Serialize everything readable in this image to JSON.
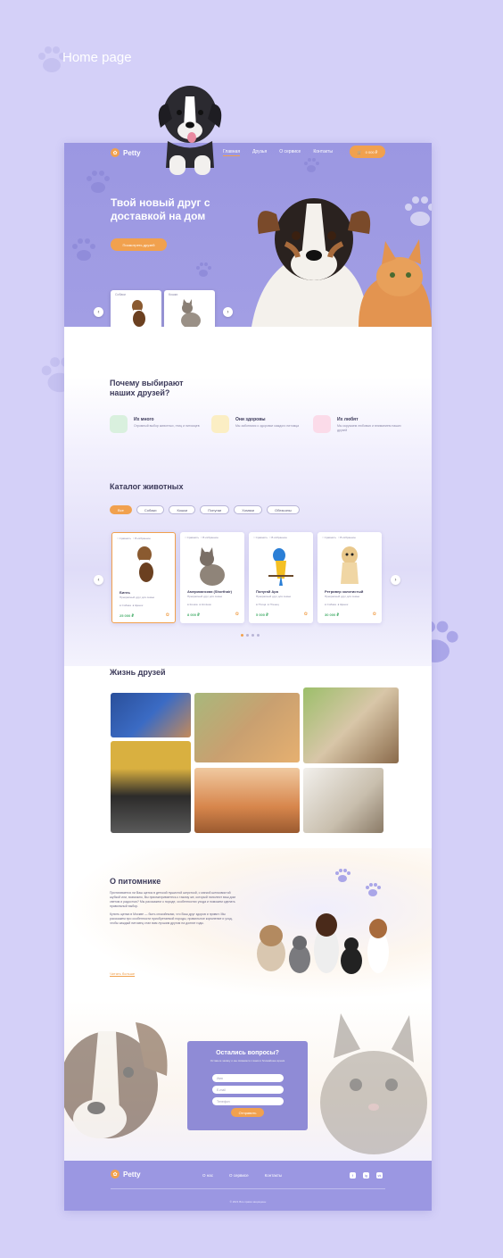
{
  "presentation": {
    "title": "Home page"
  },
  "header": {
    "brand": "Petty",
    "nav": [
      "Главная",
      "Друзья",
      "О сервисе",
      "Контакты"
    ],
    "cart": "0 000 ₽"
  },
  "hero": {
    "title": "Твой новый друг с доставкой на дом",
    "button": "Посмотреть друзей",
    "cards": [
      {
        "label": "Собаки"
      },
      {
        "label": "Кошки"
      }
    ]
  },
  "why": {
    "title": "Почему выбирают наших друзей?",
    "features": [
      {
        "title": "Их много",
        "desc": "Огромный выбор животных, птиц и питомцев"
      },
      {
        "title": "Они здоровы",
        "desc": "Мы заботимся о здоровье каждого питомца"
      },
      {
        "title": "Их любят",
        "desc": "Мы окружаем любовью и вниманием наших друзей"
      }
    ]
  },
  "catalog": {
    "title": "Каталог животных",
    "filters": [
      "Все",
      "Собаки",
      "Кошки",
      "Попугаи",
      "Хомяки",
      "Обезьяны"
    ],
    "cards": [
      {
        "name": "Бигль",
        "desc": "Прекрасный друг для семьи",
        "tag1": "Собака",
        "tag2": "Щенок",
        "price": "25 000 ₽"
      },
      {
        "name": "Американская (Shorthair)",
        "desc": "Прекрасный друг для семьи",
        "tag1": "Кошка",
        "tag2": "Котёнок",
        "price": "8 000 ₽"
      },
      {
        "name": "Попугай Ара",
        "desc": "Прекрасный друг для семьи",
        "tag1": "Птица",
        "tag2": "Птенец",
        "price": "5 000 ₽"
      },
      {
        "name": "Ретривер золотистый",
        "desc": "Прекрасный друг для семьи",
        "tag1": "Собака",
        "tag2": "Щенок",
        "price": "30 000 ₽"
      }
    ],
    "card_actions": {
      "compare": "Сравнить",
      "favorite": "В избранное"
    }
  },
  "life": {
    "title": "Жизнь друзей"
  },
  "about": {
    "title": "О питомнике",
    "p1": "Притягивается ли Ваш щенок в детской пушистой шерсткой, с мягкой шелковистой шубкой или, возможно, Вы присматриваетесь к такому же, который наполнит ваш дом светом и радостью? Мы расскажем о породе, особенностях ухода и поможем сделать правильный выбор.",
    "p2": "Купить щенка в Москве — быть спокойными, что Ваш друг здоров и привит. Мы расскажем про особенности приобретаемой породы, правильное кормление и уход, чтобы каждый питомец стал вам лучшим другом на долгие годы.",
    "link": "Читать больше"
  },
  "contact": {
    "title": "Остались вопросы?",
    "subtitle": "Оставьте заявку и мы свяжемся с вами в ближайшее время",
    "fields": [
      "Имя",
      "E-mail",
      "Телефон"
    ],
    "button": "Отправить"
  },
  "footer": {
    "brand": "Petty",
    "nav": [
      "О нас",
      "О сервисе",
      "Контакты"
    ],
    "social": [
      "f",
      "ig",
      "vk"
    ],
    "copyright": "© 2021 Все права защищены"
  },
  "colors": {
    "accent": "#f1a14e",
    "primary": "#9b97e2",
    "background": "#d4d0f8"
  }
}
